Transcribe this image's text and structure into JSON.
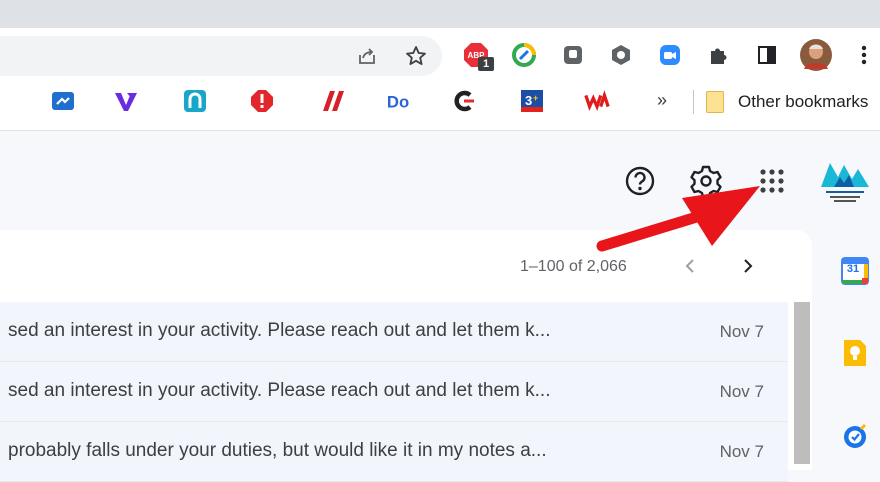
{
  "browser": {
    "extension_badge_count": "1",
    "bookmarks_overflow": "»",
    "other_bookmarks_label": "Other bookmarks"
  },
  "bookmarks": [
    {
      "name": "bookmark-1",
      "glyph": "↗",
      "color": "#1e6fd0"
    },
    {
      "name": "bookmark-2",
      "glyph": "V",
      "color": "#6a2ce0"
    },
    {
      "name": "bookmark-3",
      "glyph": "∩",
      "color": "#18a6c9"
    },
    {
      "name": "bookmark-4",
      "glyph": "!",
      "color": "#e3262c"
    },
    {
      "name": "bookmark-5",
      "glyph": "//",
      "color": "#d8202a"
    },
    {
      "name": "bookmark-6",
      "glyph": "Do",
      "color": "#2c63d8"
    },
    {
      "name": "bookmark-7",
      "glyph": "C",
      "color": "#222222"
    },
    {
      "name": "bookmark-8",
      "glyph": "3",
      "color": "#1c4ea8"
    },
    {
      "name": "bookmark-9",
      "glyph": "W",
      "color": "#e01b1b"
    }
  ],
  "pagination": {
    "range_label": "1–100 of 2,066"
  },
  "emails": [
    {
      "snippet": "sed an interest in your activity. Please reach out and let them k...",
      "date": "Nov 7"
    },
    {
      "snippet": "sed an interest in your activity. Please reach out and let them k...",
      "date": "Nov 7"
    },
    {
      "snippet": "probably falls under your duties, but would like it in my notes a...",
      "date": "Nov 7"
    }
  ],
  "side_panel": {
    "calendar_day": "31"
  },
  "colors": {
    "annotation_arrow": "#e8161b",
    "gmail_surface": "#f6f8fc",
    "row_unread_bg": "#f2f6fc"
  }
}
